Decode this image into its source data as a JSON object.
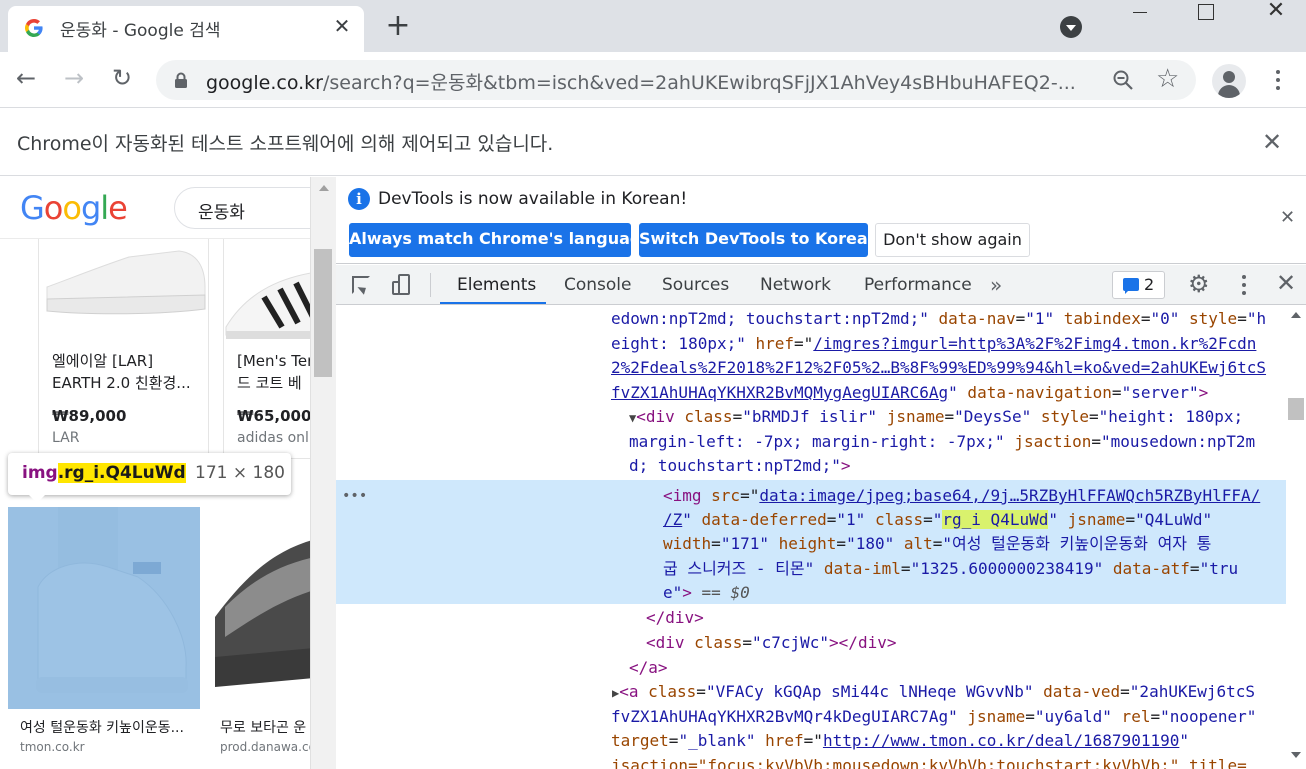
{
  "browser": {
    "tab": {
      "title": "운동화 - Google 검색"
    },
    "url": {
      "host": "google.co.kr",
      "path": "/search?q=운동화&tbm=isch&ved=2ahUKEwibrqSFjJX1AhVey4sBHbuHAFEQ2-..."
    },
    "infobar": {
      "text": "Chrome이 자동화된 테스트 소프트웨어에 의해 제어되고 있습니다."
    }
  },
  "google": {
    "logo": "Google",
    "query": "운동화",
    "cards": [
      {
        "title": "엘에이알 [LAR]",
        "subtitle": "EARTH 2.0 친환경...",
        "price": "₩89,000",
        "source": "LAR"
      },
      {
        "title": "[Men's Ter",
        "subtitle": "드 코트 베",
        "price": "₩65,000",
        "source": "adidas onl"
      }
    ],
    "tooltip": {
      "selector_prefix": "img",
      "selector_highlight": ".rg_i.Q4LuWd",
      "size": "171 × 180"
    },
    "results": [
      {
        "title": "여성 털운동화 키높이운동...",
        "source": "tmon.co.kr"
      },
      {
        "title": "무로 보타곤 운",
        "source": "prod.danawa.co"
      }
    ]
  },
  "devtools": {
    "banner": {
      "text": "DevTools is now available in Korean!",
      "info_icon": "i",
      "btn_match": "Always match Chrome's language",
      "btn_switch": "Switch DevTools to Korean",
      "btn_dismiss": "Don't show again"
    },
    "tabs": [
      "Elements",
      "Console",
      "Sources",
      "Network",
      "Performance"
    ],
    "more_tabs": "»",
    "issues_count": "2",
    "code": {
      "l1": {
        "a": "edown:npT2md; touchstart:npT2md;\"",
        "b": " data-nav",
        "c": "=",
        "d": "\"1\"",
        "e": " tabindex",
        "f": "=",
        "g": "\"0\"",
        "h": " style",
        "i": "=",
        "j": "\"h"
      },
      "l2": "eight: 180px;\"",
      "l2_attr": " href",
      "l2_link": "/imgres?imgurl=http%3A%2F%2Fimg4.tmon.kr%2Fcdn",
      "l3_link": "2%2Fdeals%2F2018%2F12%2F05%2…B%8F%99%ED%99%94&hl=ko&ved=2ahUKEwj6tcS",
      "l4_link": "fvZX1AhUHAqYKHXR2BvMQMygAegUIARC6Ag",
      "l4_attr": " data-navigation",
      "l4_val": "\"server\"",
      "l5_tag": "<div",
      "l5_a1": " class",
      "l5_v1": "\"bRMDJf islir\"",
      "l5_a2": " jsname",
      "l5_v2": "\"DeysSe\"",
      "l5_a3": " style",
      "l5_v3": "\"height: 180px;",
      "l6_v": "margin-left: -7px; margin-right: -7px;\"",
      "l6_a": " jsaction",
      "l6_v2": "\"mousedown:npT2m",
      "l7_v": "d; touchstart:npT2md;\"",
      "l8_tag": "<img",
      "l8_a": " src",
      "l8_link": "data:image/jpeg;base64,/9j…5RZByHlFFAWQch5RZByHlFFA/",
      "l9_link": "/Z",
      "l9_a1": " data-deferred",
      "l9_v1": "\"1\"",
      "l9_a2": " class",
      "l9_v2_q": "\"",
      "l9_v2": "rg_i Q4LuWd",
      "l9_a3": " jsname",
      "l9_v3": "\"Q4LuWd\"",
      "l10_a1": "width",
      "l10_v1": "\"171\"",
      "l10_a2": " height",
      "l10_v2": "\"180\"",
      "l10_a3": " alt",
      "l10_v3": "\"여성 털운동화 키높이운동화 여자 통",
      "l11_v": "굽 스니커즈 - 티몬\"",
      "l11_a1": " data-iml",
      "l11_v1": "\"1325.6000000238419\"",
      "l11_a2": " data-atf",
      "l11_v2": "\"tru",
      "l12_v": "e\"",
      "l12_ph": " == $0",
      "l13": "</div>",
      "l14_tag": "<div",
      "l14_a": " class",
      "l14_v": "\"c7cjWc\"",
      "l14_close": "</div>",
      "l15": "</a>",
      "l16_tag": "<a",
      "l16_a1": " class",
      "l16_v1": "\"VFACy kGQAp sMi44c lNHeqe WGvvNb\"",
      "l16_a2": " data-ved",
      "l16_v2": "\"2ahUKEwj6tcS",
      "l17_v": "fvZX1AhUHAqYKHXR2BvMQr4kDegUIARC7Ag\"",
      "l17_a1": " jsname",
      "l17_v1": "\"uy6ald\"",
      "l17_a2": " rel",
      "l17_v2": "\"noopener\"",
      "l18_a1": "target",
      "l18_v1": "\"_blank\"",
      "l18_a2": " href",
      "l18_link": "http://www.tmon.co.kr/deal/1687901190",
      "l19": "jsaction=\"focus:kvVbVb;mousedown:kvVbVb;touchstart:kvVbVb;\" title="
    }
  }
}
